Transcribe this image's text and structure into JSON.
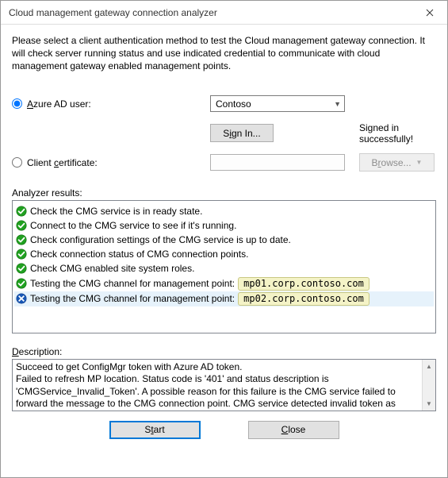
{
  "title": "Cloud management gateway connection analyzer",
  "intro": "Please select a client authentication method to test the Cloud management gateway connection. It will check server running status and use indicated credential to communicate with cloud management gateway enabled management points.",
  "auth": {
    "azure_label_prefix": "A",
    "azure_label_rest": "zure AD user:",
    "cert_label_prefix": "Client ",
    "cert_label_underline": "c",
    "cert_label_rest": "ertificate:",
    "tenant_selected": "Contoso",
    "signin_prefix": "S",
    "signin_underline": "i",
    "signin_rest": "gn In...",
    "signed_in_status": "Signed in successfully!",
    "cert_value": "",
    "browse_prefix": "B",
    "browse_underline": "r",
    "browse_rest": "owse..."
  },
  "sections": {
    "results_label": "Analyzer results:",
    "desc_label_prefix": "",
    "desc_label_underline": "D",
    "desc_label_rest": "escription:"
  },
  "results": [
    {
      "status": "ok",
      "text": "Check the CMG service is in ready state.",
      "tag": ""
    },
    {
      "status": "ok",
      "text": "Connect to the CMG service to see if it's running.",
      "tag": ""
    },
    {
      "status": "ok",
      "text": "Check configuration settings of the CMG service is up to date.",
      "tag": ""
    },
    {
      "status": "ok",
      "text": "Check connection status of CMG connection points.",
      "tag": ""
    },
    {
      "status": "ok",
      "text": "Check CMG enabled site system roles.",
      "tag": ""
    },
    {
      "status": "ok",
      "text": "Testing the CMG channel for management point:",
      "tag": "mp01.corp.contoso.com"
    },
    {
      "status": "fail",
      "text": "Testing the CMG channel for management point:",
      "tag": "mp02.corp.contoso.com",
      "selected": true
    }
  ],
  "description": "Succeed to get ConfigMgr token with Azure AD token.\nFailed to refresh MP location. Status code is '401' and status description is 'CMGService_Invalid_Token'. A possible reason for this failure is the CMG service failed to forward the message to the CMG connection point. CMG service detected invalid token as client credential.",
  "buttons": {
    "start_prefix": "S",
    "start_underline": "t",
    "start_rest": "art",
    "close_prefix": "",
    "close_underline": "C",
    "close_rest": "lose"
  }
}
